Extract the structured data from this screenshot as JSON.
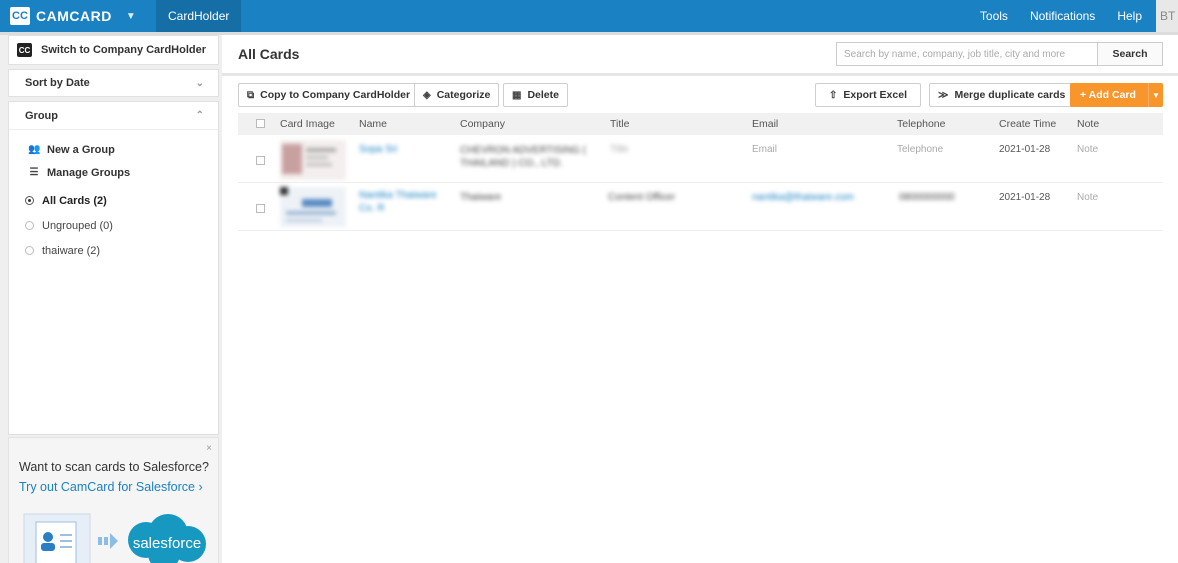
{
  "topbar": {
    "logo_mark": "CC",
    "brand": "CAMCARD",
    "active_tab": "CardHolder",
    "links": [
      "Tools",
      "Notifications",
      "Help"
    ],
    "user_initials": "BT"
  },
  "sidebar": {
    "switch_label": "Switch to Company CardHolder",
    "switch_mark": "CC",
    "sort_label": "Sort by Date",
    "group_title": "Group",
    "new_group": "New a Group",
    "manage_groups": "Manage Groups",
    "groups": [
      {
        "label": "All Cards  (2)",
        "selected": true
      },
      {
        "label": "Ungrouped  (0)",
        "selected": false
      },
      {
        "label": "thaiware  (2)",
        "selected": false
      }
    ]
  },
  "promo": {
    "close": "×",
    "title": "Want to scan cards to Salesforce?",
    "link": "Try out CamCard for Salesforce ›",
    "logo_text": "salesforce"
  },
  "main": {
    "title": "All Cards",
    "search_placeholder": "Search by name, company, job title, city and more",
    "search_button": "Search",
    "toolbar": {
      "copy": "Copy to Company CardHolder",
      "categorize": "Categorize",
      "delete": "Delete",
      "export": "Export Excel",
      "merge": "Merge duplicate cards",
      "add": "+ Add Card"
    },
    "columns": [
      "Card Image",
      "Name",
      "Company",
      "Title",
      "Email",
      "Telephone",
      "Create Time",
      "Note"
    ],
    "rows": [
      {
        "name": "Sopa Sri",
        "company": "CHEVRON ADVERTISING ( THAILAND ) CO., LTD.",
        "title": "Title",
        "email": "Email",
        "telephone": "Telephone",
        "create_time": "2021-01-28",
        "note": "Note"
      },
      {
        "name": "Nantika Thaiware Co. R",
        "company": "Thaiware",
        "title": "Content Officer",
        "email": "nantika@thaiware.com",
        "telephone": "0800000000",
        "create_time": "2021-01-28",
        "note": "Note"
      }
    ]
  },
  "colors": {
    "topbar": "#1a82c3",
    "accent_orange": "#f8952b",
    "link_blue": "#1a82c3",
    "salesforce_blue": "#1798c1"
  }
}
